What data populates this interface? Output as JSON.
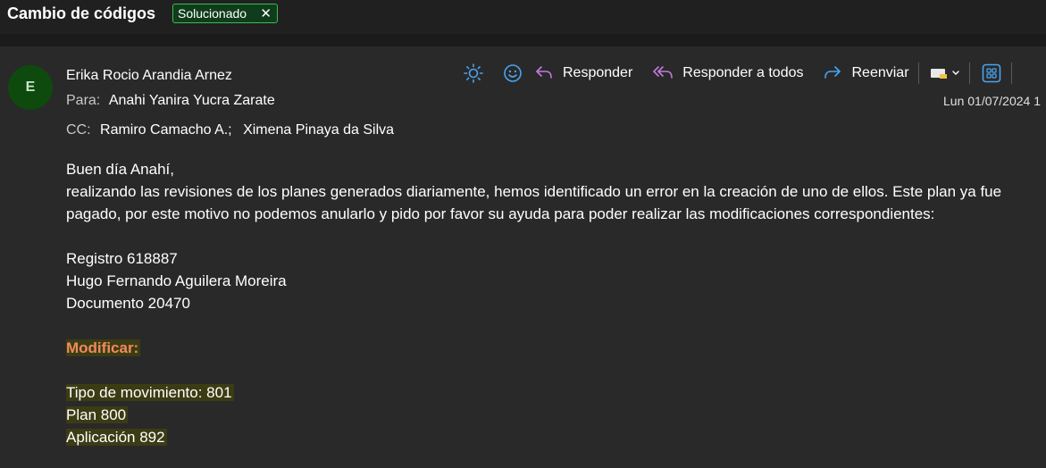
{
  "header": {
    "subject": "Cambio de códigos",
    "tag_label": "Solucionado",
    "tag_close": "✕"
  },
  "message": {
    "avatar_initial": "E",
    "sender": "Erika Rocio Arandia Arnez",
    "to_label": "Para:",
    "to": [
      "Anahi Yanira Yucra Zarate"
    ],
    "cc_label": "CC:",
    "cc": [
      "Ramiro Camacho A.;",
      "Ximena Pinaya da Silva"
    ],
    "date": "Lun 01/07/2024 1"
  },
  "toolbar": {
    "reply_label": "Responder",
    "reply_all_label": "Responder a todos",
    "forward_label": "Reenviar"
  },
  "body": {
    "greeting": "Buen día Anahí,",
    "paragraph": "realizando las revisiones de los planes generados diariamente, hemos identificado un error en la creación de uno de ellos. Este plan ya fue pagado, por este motivo no podemos anularlo y pido por favor su ayuda para poder realizar las modificaciones correspondientes:",
    "registro": "Registro 618887",
    "nombre": "Hugo Fernando Aguilera Moreira",
    "documento": "Documento 20470",
    "modificar": "Modificar:",
    "tipo_movimiento": "Tipo de movimiento: 801",
    "plan": "Plan 800",
    "aplicacion": "Aplicación 892"
  },
  "colors": {
    "tag_border": "#3fb950",
    "avatar_bg": "#0e4a0e",
    "accent_icon": "#4aa3f0",
    "reply_icon": "#c678dd",
    "modificar_text": "#f08a5d",
    "highlight_bg": "#3c3c14"
  },
  "icons": [
    "sun-icon",
    "smiley-icon",
    "reply-icon",
    "reply-all-icon",
    "forward-icon",
    "tag-dropdown-icon",
    "apps-icon"
  ]
}
